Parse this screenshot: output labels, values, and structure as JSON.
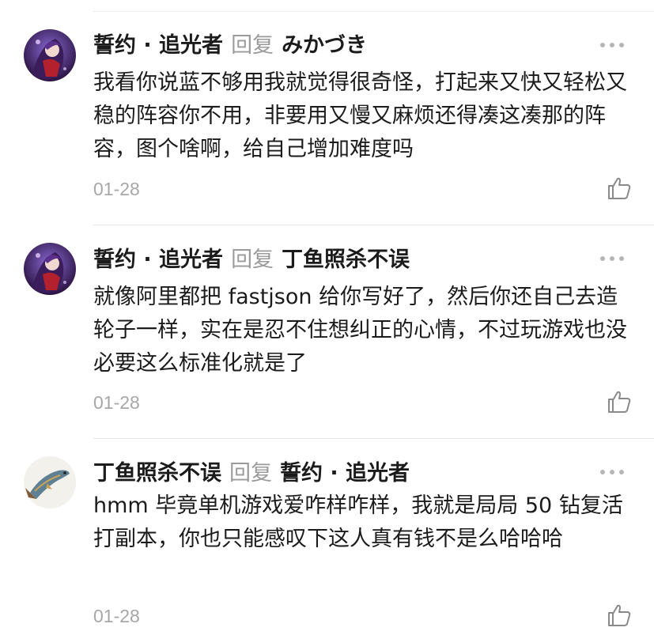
{
  "comments": [
    {
      "author": "誓约 · 追光者",
      "reply_label": "回复",
      "reply_to": "みかづき",
      "text": "我看你说蓝不够用我就觉得很奇怪，打起来又快又轻松又稳的阵容你不用，非要用又慢又麻烦还得凑这凑那的阵容，图个啥啊，给自己增加难度吗",
      "date": "01-28",
      "avatar_icon": "anime-character-avatar-icon"
    },
    {
      "author": "誓约 · 追光者",
      "reply_label": "回复",
      "reply_to": "丁鱼照杀不误",
      "text": "就像阿里都把 fastjson 给你写好了，然后你还自己去造轮子一样，实在是忍不住想纠正的心情，不过玩游戏也没必要这么标准化就是了",
      "date": "01-28",
      "avatar_icon": "anime-character-avatar-icon"
    },
    {
      "author": "丁鱼照杀不误",
      "reply_label": "回复",
      "reply_to": "誓约 · 追光者",
      "text": "hmm 毕竟单机游戏爱咋样咋样，我就是局局 50 钻复活打副本，你也只能感叹下这人真有钱不是么哈哈哈",
      "date": "01-28",
      "avatar_icon": "fish-avatar-icon"
    }
  ],
  "icons": {
    "more": "more-dots-icon",
    "like": "thumbs-up-icon"
  }
}
